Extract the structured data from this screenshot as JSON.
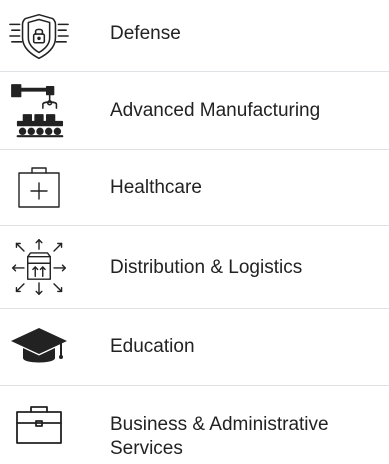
{
  "list": {
    "items": [
      {
        "label": "Defense",
        "icon": "shield-lock-icon"
      },
      {
        "label": "Advanced Manufacturing",
        "icon": "robotic-arm-conveyor-icon"
      },
      {
        "label": "Healthcare",
        "icon": "first-aid-kit-icon"
      },
      {
        "label": "Distribution & Logistics",
        "icon": "package-distribution-icon"
      },
      {
        "label": "Education",
        "icon": "graduation-cap-icon"
      },
      {
        "label": "Business & Administrative Services",
        "icon": "briefcase-icon"
      }
    ]
  },
  "colors": {
    "text": "#222222",
    "divider": "#dfe3e6",
    "icon": "#222222"
  }
}
